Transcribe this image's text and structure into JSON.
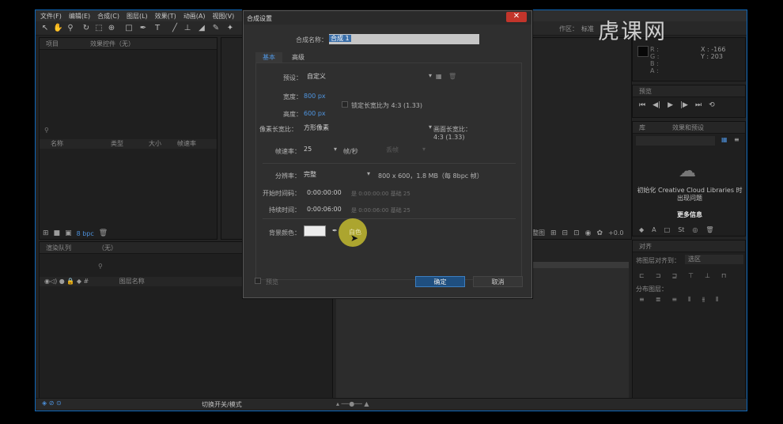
{
  "watermark": {
    "brand": "虎课网"
  },
  "menu": [
    "文件(F)",
    "编辑(E)",
    "合成(C)",
    "图层(L)",
    "效果(T)",
    "动画(A)",
    "视图(V)"
  ],
  "toolbar": {
    "workspace_label": "作区：",
    "workspace_value": "标准"
  },
  "project_panel": {
    "tab_project": "项目",
    "tab_effects": "效果控件（无）",
    "columns": [
      "名称",
      "类型",
      "大小",
      "帧速率"
    ],
    "bpc": "8 bpc"
  },
  "info_panel": {
    "r": "R :",
    "g": "G :",
    "b": "B :",
    "a": "A :",
    "x": "X : -166",
    "y": "Y : 203"
  },
  "preview_panel": {
    "title": "预览"
  },
  "library_panel": {
    "tab_lib": "库",
    "tab_effects": "效果和预设",
    "cc_message": "初始化 Creative Cloud Libraries 时出现问题",
    "more_info": "更多信息"
  },
  "align_panel": {
    "title": "对齐",
    "align_to_label": "将图层对齐到：",
    "align_to_value": "选区",
    "distribute_label": "分布图层："
  },
  "render_panel": {
    "tab_render": "渲染队列",
    "tab_none": "（无）",
    "col_layer": "图层名称",
    "toggle_label": "切换开关/模式"
  },
  "viewer": {
    "zoom_label": "完整图",
    "plus": "+0.0"
  },
  "dialog": {
    "title": "合成设置",
    "close": "✕",
    "name_label": "合成名称：",
    "name_value": "合成 1",
    "tab_basic": "基本",
    "tab_advanced": "高级",
    "preset_label": "预设：",
    "preset_value": "自定义",
    "width_label": "宽度：",
    "width_value": "800 px",
    "height_label": "高度：",
    "height_value": "600 px",
    "lock_ratio": "锁定长宽比为 4:3 (1.33)",
    "par_label": "像素长宽比：",
    "par_value": "方形像素",
    "frame_ratio_label": "画面长宽比：",
    "frame_ratio_value": "4:3 (1.33)",
    "fps_label": "帧速率：",
    "fps_value": "25",
    "fps_unit": "帧/秒",
    "fps_drop": "丢帧",
    "res_label": "分辨率：",
    "res_value": "完整",
    "res_info": "800 x 600，1.8 MB（每 8bpc 帧）",
    "start_label": "开始时间码：",
    "start_value": "0:00:00:00",
    "start_info": "是 0:00:00:00  基础 25",
    "dur_label": "持续时间：",
    "dur_value": "0:00:06:00",
    "dur_info": "是 0:00:06:00  基础 25",
    "bg_label": "背景颜色：",
    "bg_text": "白色",
    "preview": "预览",
    "ok": "确定",
    "cancel": "取消"
  },
  "colors": {
    "accent_blue": "#4c8fd9",
    "title_close": "#c2352b",
    "cursor_highlight": "#c8c030"
  }
}
